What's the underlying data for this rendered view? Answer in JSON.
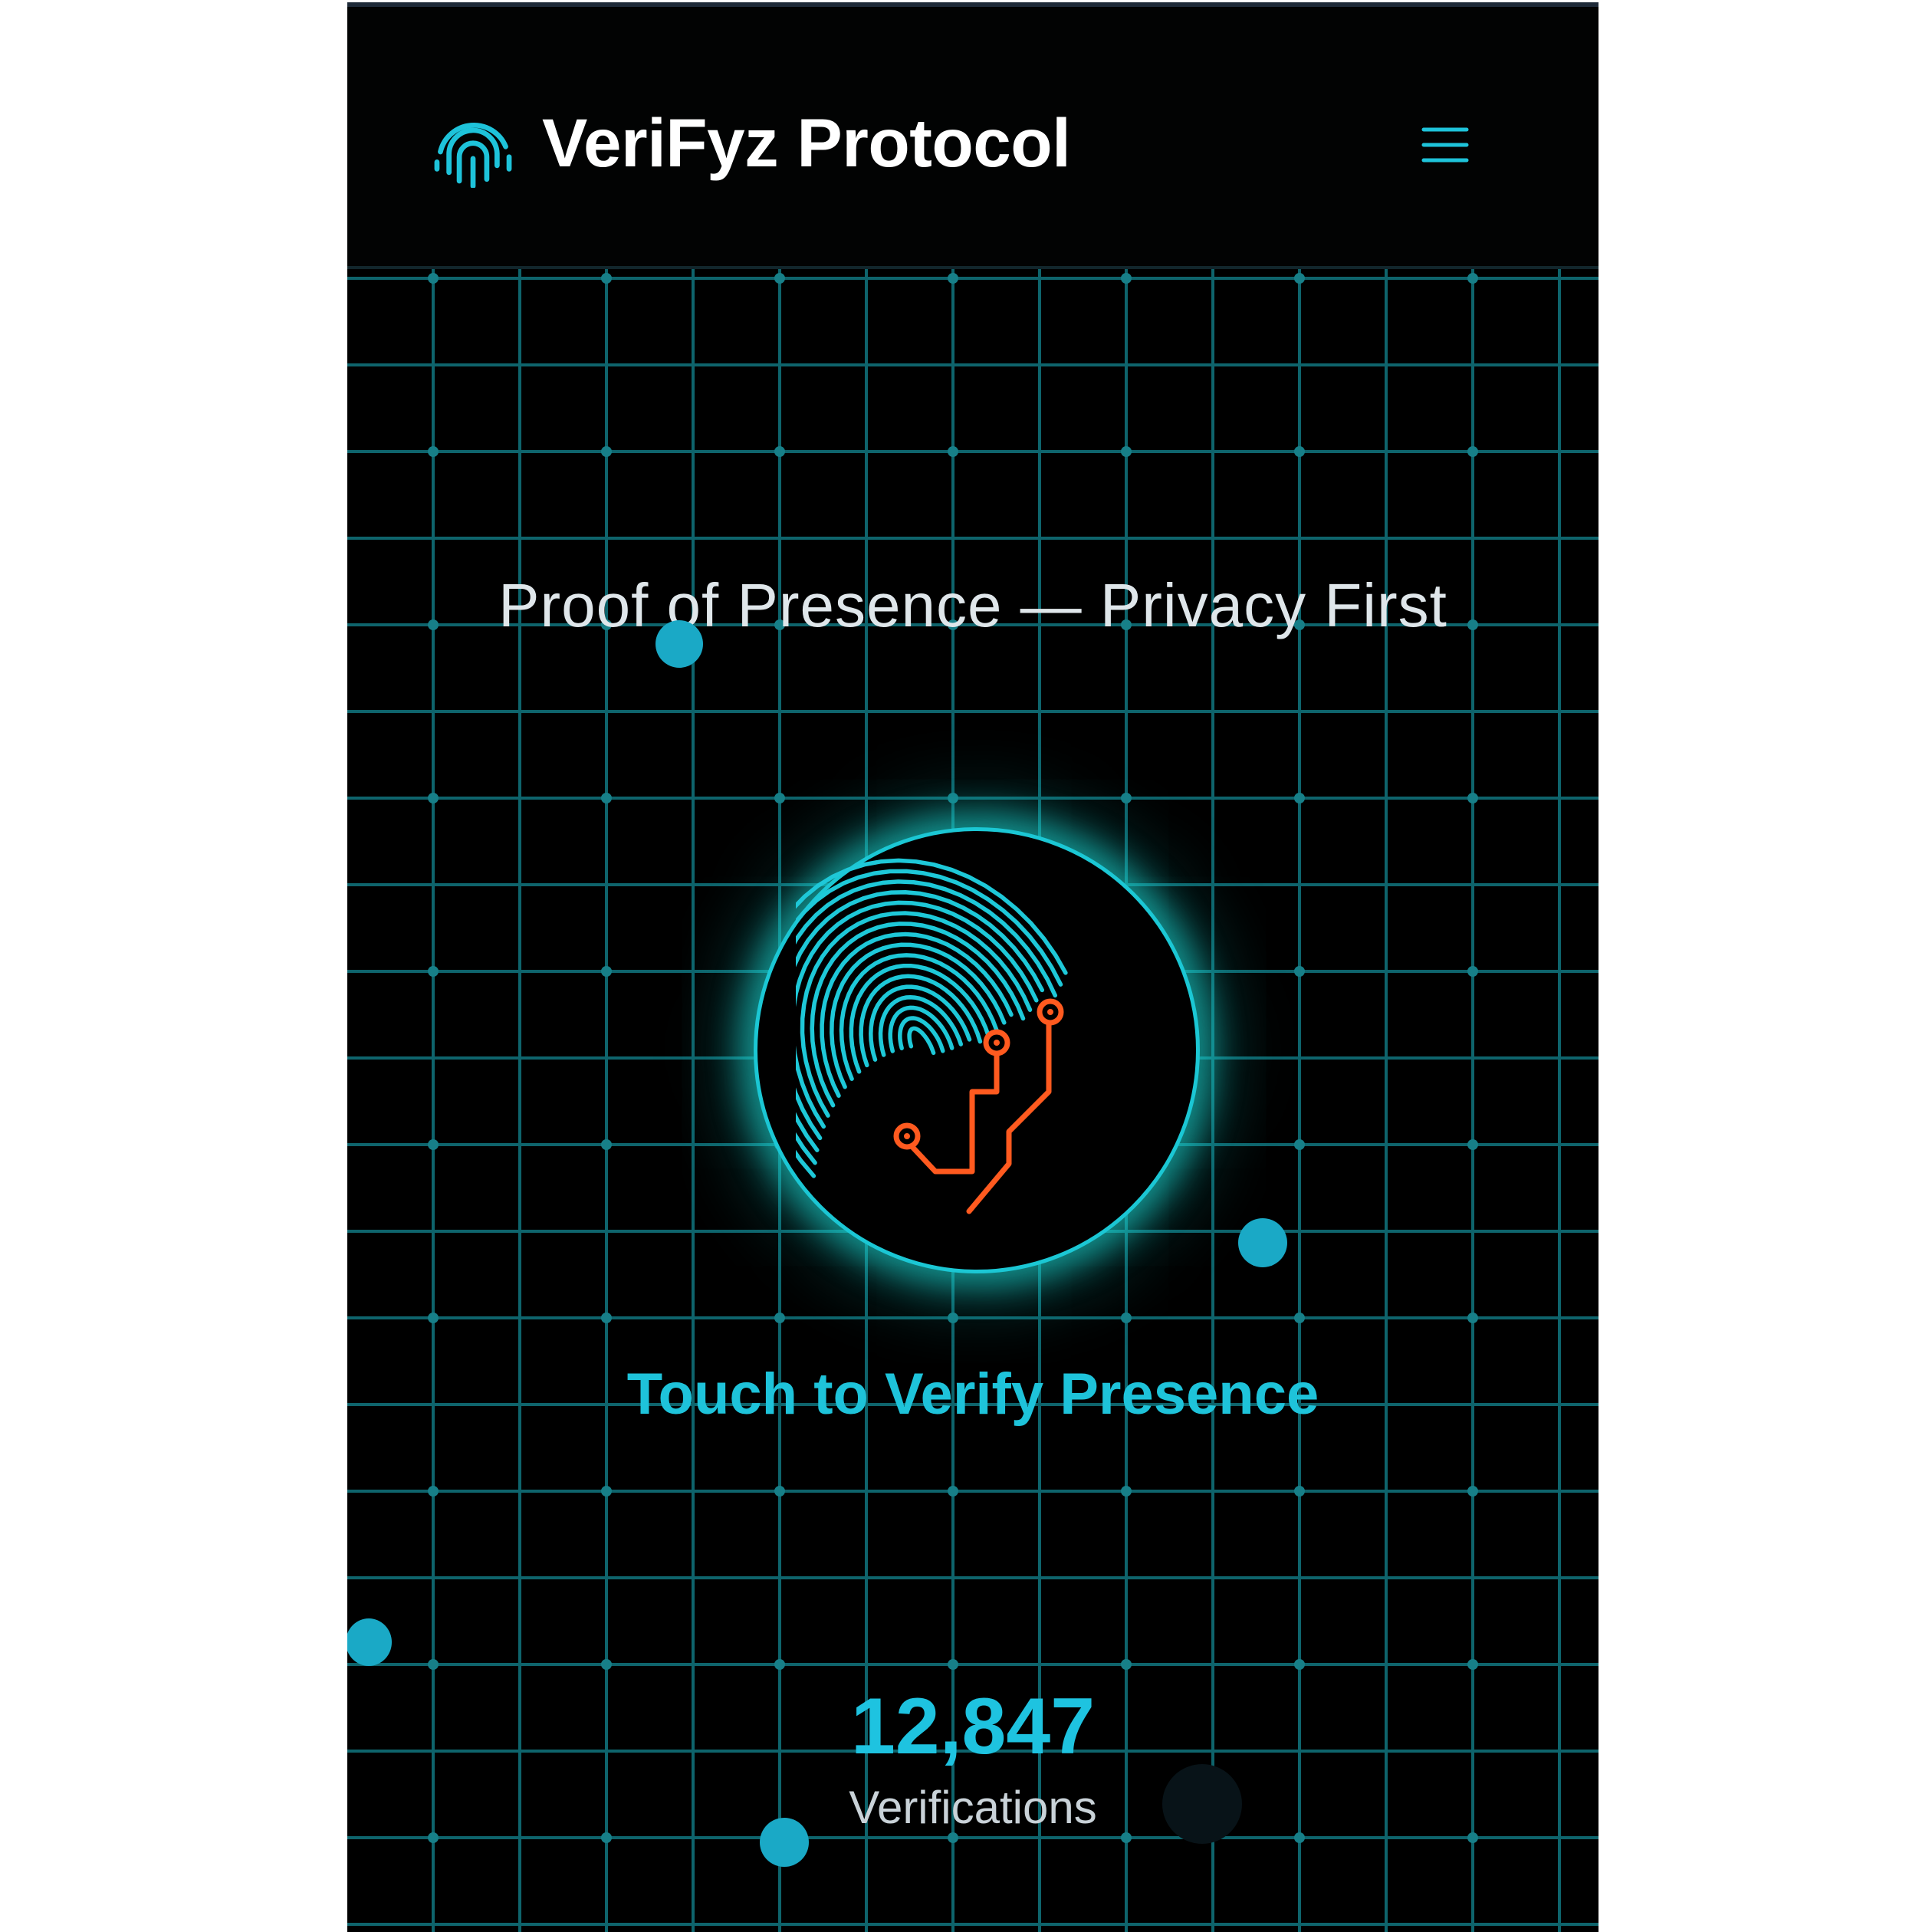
{
  "header": {
    "app_title": "VeriFyz Protocol",
    "logo_icon": "fingerprint-icon",
    "menu_icon": "hamburger-menu-icon"
  },
  "hero": {
    "tagline": "Proof of Presence — Privacy First",
    "scan_icon": "fingerprint-circuit-icon",
    "cta_label": "Touch to Verify Presence"
  },
  "stats": {
    "count": "12,847",
    "label": "Verifications"
  },
  "colors": {
    "background": "#000000",
    "accent_cyan": "#1ec3da",
    "circuit_orange": "#ff5a1f",
    "grid_line": "#0f6a72",
    "title_text": "#ffffff"
  }
}
